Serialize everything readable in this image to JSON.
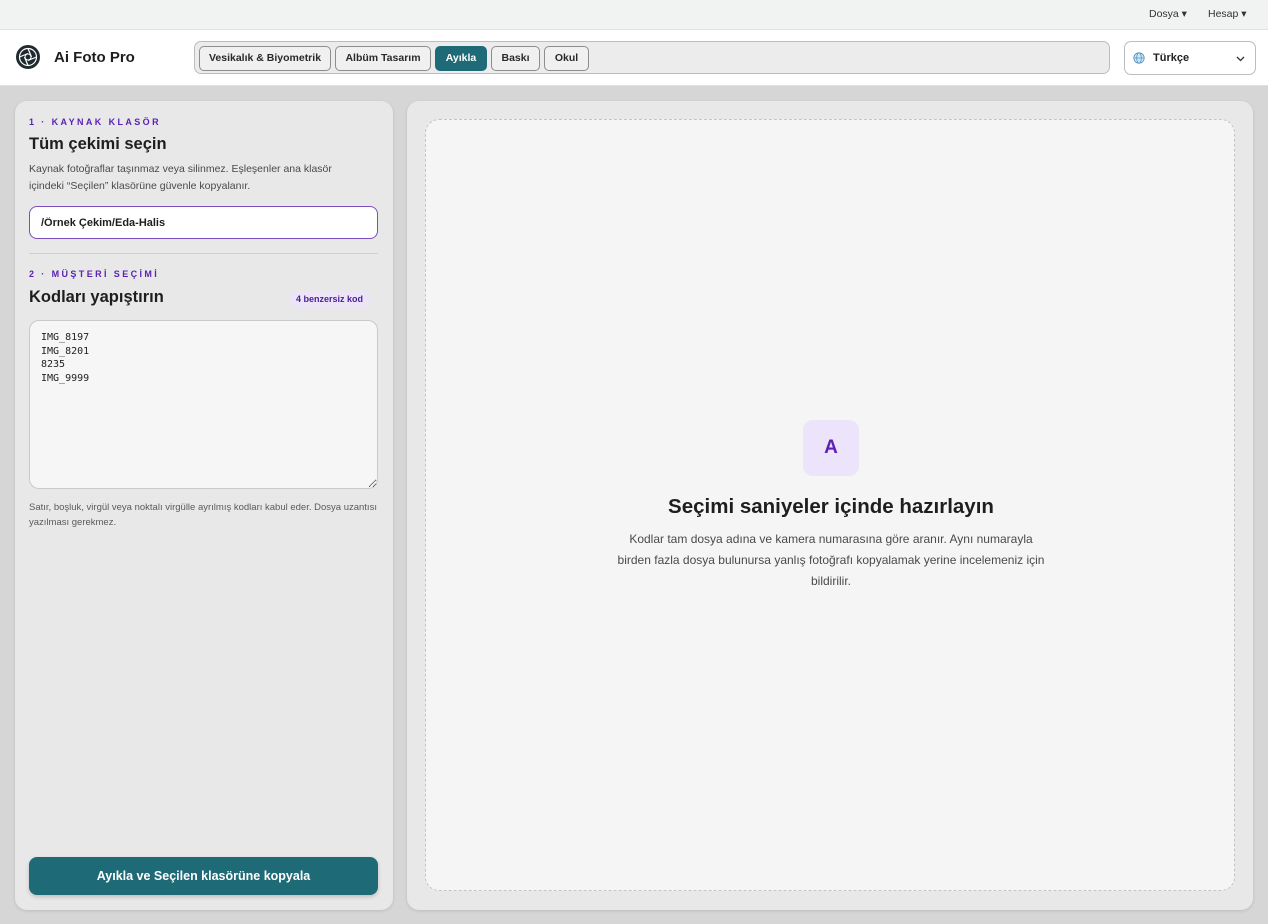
{
  "menubar": {
    "file": "Dosya ▾",
    "account": "Hesap ▾"
  },
  "header": {
    "app_title": "Ai Foto Pro",
    "tabs": [
      {
        "label": "Vesikalık & Biyometrik",
        "active": false
      },
      {
        "label": "Albüm Tasarım",
        "active": false
      },
      {
        "label": "Ayıkla",
        "active": true
      },
      {
        "label": "Baskı",
        "active": false
      },
      {
        "label": "Okul",
        "active": false
      }
    ],
    "language": {
      "selected": "Türkçe",
      "icon": "globe-icon"
    }
  },
  "left": {
    "source": {
      "step": "1 · KAYNAK KLASÖR",
      "title": "Tüm çekimi seçin",
      "description": "Kaynak fotoğraflar taşınmaz veya silinmez. Eşleşenler ana klasör içindeki “Seçilen” klasörüne güvenle kopyalanır.",
      "folder_value": "/Örnek Çekim/Eda-Halis"
    },
    "selection": {
      "step": "2 · MÜŞTERİ SEÇİMİ",
      "title": "Kodları yapıştırın",
      "badge": "4 benzersiz kod",
      "codes": "IMG_8197\nIMG_8201\n8235\nIMG_9999",
      "hint": "Satır, boşluk, virgül veya noktalı virgülle ayrılmış kodları kabul eder. Dosya uzantısı yazılması gerekmez."
    },
    "run_button": "Ayıkla ve Seçilen klasörüne kopyala"
  },
  "right": {
    "empty_state": {
      "icon_letter": "A",
      "title": "Seçimi saniyeler içinde hazırlayın",
      "description": "Kodlar tam dosya adına ve kamera numarasına göre aranır. Aynı numarayla birden fazla dosya bulunursa yanlış fotoğrafı kopyalamak yerine incelemeniz için bildirilir."
    }
  },
  "colors": {
    "accent": "#1e6a77",
    "purple": "#5b21b6",
    "badge_bg": "#ece4f7"
  }
}
